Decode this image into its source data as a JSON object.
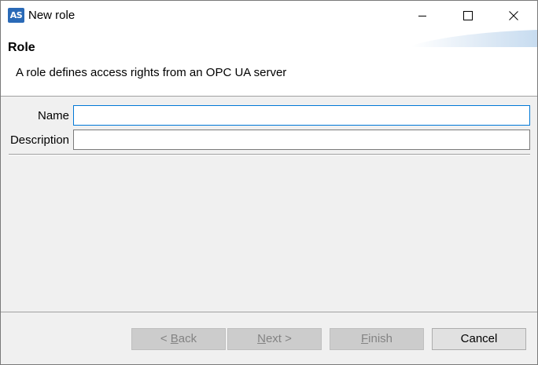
{
  "window": {
    "app_icon_text": "AS",
    "title": "New role"
  },
  "banner": {
    "title": "Role",
    "description": "A role defines access rights from an OPC UA server"
  },
  "form": {
    "name_label": "Name",
    "name_value": "",
    "description_label": "Description",
    "description_value": ""
  },
  "buttons": {
    "back_prefix": "< ",
    "back_key": "B",
    "back_rest": "ack",
    "next_key": "N",
    "next_rest": "ext >",
    "finish_key": "F",
    "finish_rest": "inish",
    "cancel": "Cancel"
  },
  "colors": {
    "accent": "#0078d7",
    "app_icon": "#2a6ab7"
  }
}
